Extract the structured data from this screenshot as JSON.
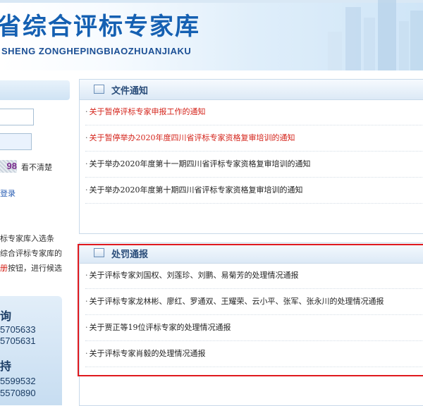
{
  "header": {
    "title": "省综合评标专家库",
    "pinyin": "SHENG ZONGHEPINGBIAOZHUANJIAKU"
  },
  "sidebar": {
    "captcha_text": "98",
    "refresh_label": "看不清楚",
    "login_link": "登录",
    "notice_lines": [
      "标专家库入选条",
      "综合评标专家库的",
      "册"
    ],
    "notice_tail": "按钮，进行候选",
    "contact": {
      "query_heading": "询",
      "query_phone_1": "5705633",
      "query_phone_2": "5705631",
      "support_heading": "持",
      "support_phone_1": "5599532",
      "support_phone_2": "5570890"
    }
  },
  "file_notice": {
    "title": "文件通知",
    "items": [
      {
        "text": "关于暂停评标专家申报工作的通知",
        "color": "#d4231a"
      },
      {
        "text": "关于暂停举办2020年度四川省评标专家资格复审培训的通知",
        "color": "#d4231a"
      },
      {
        "text": "关于举办2020年度第十一期四川省评标专家资格复审培训的通知",
        "color": "#222222"
      },
      {
        "text": "关于举办2020年度第十期四川省评标专家资格复审培训的通知",
        "color": "#222222"
      }
    ]
  },
  "penalty_notice": {
    "title": "处罚通报",
    "items": [
      {
        "text": "关于评标专家刘国权、刘莲珍、刘鹏、易菊芳的处理情况通报"
      },
      {
        "text": "关于评标专家龙林彬、廖红、罗通双、王耀荣、云小平、张军、张永川的处理情况通报"
      },
      {
        "text": "关于贾正等19位评标专家的处理情况通报"
      },
      {
        "text": "关于评标专家肖毅的处理情况通报"
      }
    ]
  },
  "bullet": "·",
  "colors": {
    "accent": "#1560b2",
    "highlight_box": "#e0191e"
  }
}
